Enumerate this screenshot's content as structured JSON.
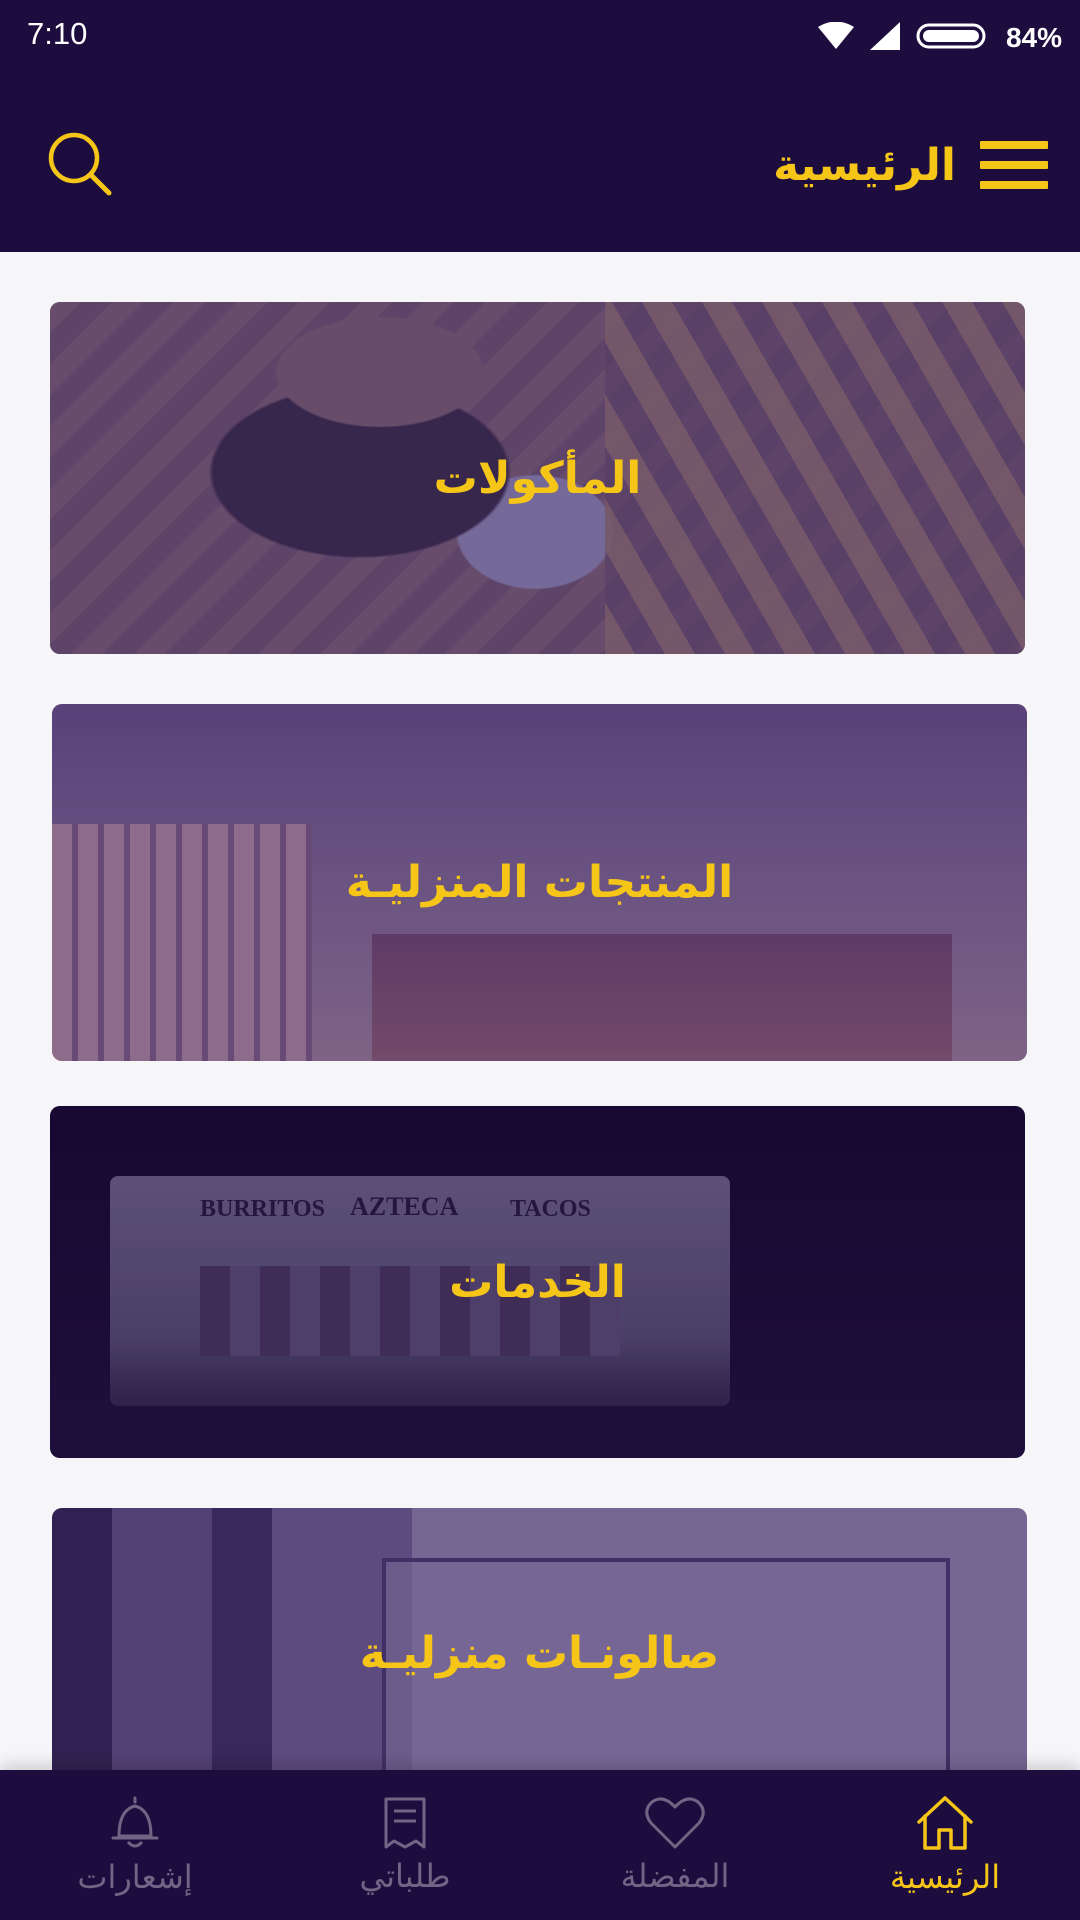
{
  "status_bar": {
    "time": "7:10",
    "battery": "84%",
    "icons": [
      "wifi-icon",
      "signal-icon",
      "battery-icon"
    ]
  },
  "header": {
    "title": "الرئيسية",
    "menu_icon": "hamburger-menu-icon",
    "search_icon": "search-icon"
  },
  "categories": [
    {
      "label": "المأكولات",
      "image": "burger-and-fries-photo"
    },
    {
      "label": "المنتجات المنزليـة",
      "image": "cafe-interior-photo"
    },
    {
      "label": "الخدمات",
      "image": "food-truck-photo",
      "photo_text": [
        "BURRITOS",
        "AZTECA",
        "TACOS"
      ]
    },
    {
      "label": "صالونـات منزليـة",
      "image": "hair-studio-window-photo"
    }
  ],
  "bottom_nav": {
    "items": [
      {
        "label": "إشعارات",
        "icon": "bell-icon",
        "active": false
      },
      {
        "label": "طلباتي",
        "icon": "receipt-icon",
        "active": false
      },
      {
        "label": "المفضلة",
        "icon": "heart-icon",
        "active": false
      },
      {
        "label": "الرئيسية",
        "icon": "home-icon",
        "active": true
      }
    ]
  },
  "colors": {
    "primary_dark": "#1d0c3e",
    "accent": "#f5c518",
    "inactive": "#6f6585",
    "background": "#f6f6f8"
  }
}
